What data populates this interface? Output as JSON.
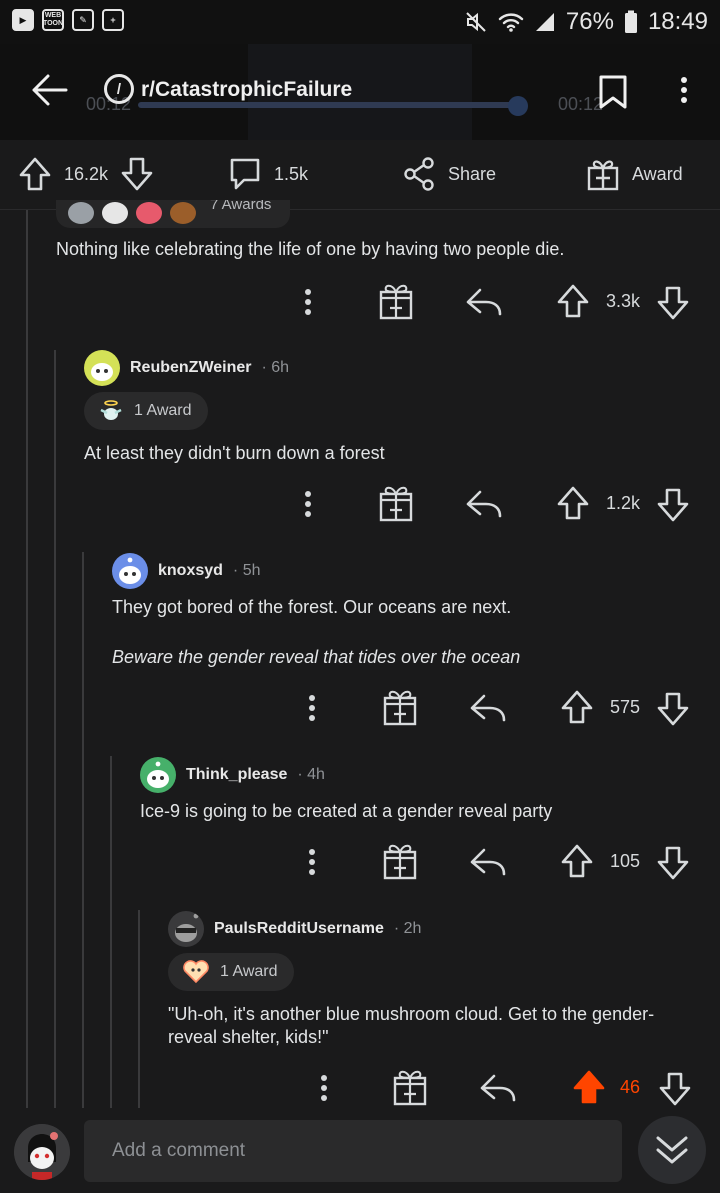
{
  "status_bar": {
    "battery": "76%",
    "time": "18:49",
    "webtoon_label": "WEB TOON"
  },
  "header": {
    "subreddit": "r/CatastrophicFailure",
    "video_elapsed": "00:12",
    "video_remaining": "00:12"
  },
  "post_actions": {
    "upvotes": "16.2k",
    "comments": "1.5k",
    "share_label": "Share",
    "award_label": "Award"
  },
  "comments": [
    {
      "awards": "7 Awards",
      "text": "Nothing like celebrating the life of one by having two people die.",
      "score": "3.3k"
    },
    {
      "author": "ReubenZWeiner",
      "age": "· 6h",
      "award": "1 Award",
      "text": "At least they didn't burn down a forest",
      "score": "1.2k"
    },
    {
      "author": "knoxsyd",
      "age": "· 5h",
      "text": "They got bored of the forest. Our oceans are next.",
      "text2": "Beware the gender reveal that tides over the ocean",
      "score": "575"
    },
    {
      "author": "Think_please",
      "age": "· 4h",
      "text": "Ice-9 is going to be created at a gender reveal party",
      "score": "105"
    },
    {
      "author": "PaulsRedditUsername",
      "age": "· 2h",
      "award": "1 Award",
      "text": "\"Uh-oh, it's another blue mushroom cloud. Get to the gender-reveal shelter, kids!\"",
      "score": "46",
      "upvoted": true
    }
  ],
  "bottom_bar": {
    "comment_placeholder": "Add a comment"
  },
  "colors": {
    "upvote_active": "#ff4500",
    "background": "#1a1a1b",
    "text": "#d7dadc"
  },
  "icons": [
    "back-arrow-icon",
    "subreddit-icon",
    "bookmark-icon",
    "more-vertical-icon",
    "upvote-icon",
    "downvote-icon",
    "comment-icon",
    "share-icon",
    "gift-icon",
    "reply-icon",
    "chevron-double-down-icon"
  ]
}
